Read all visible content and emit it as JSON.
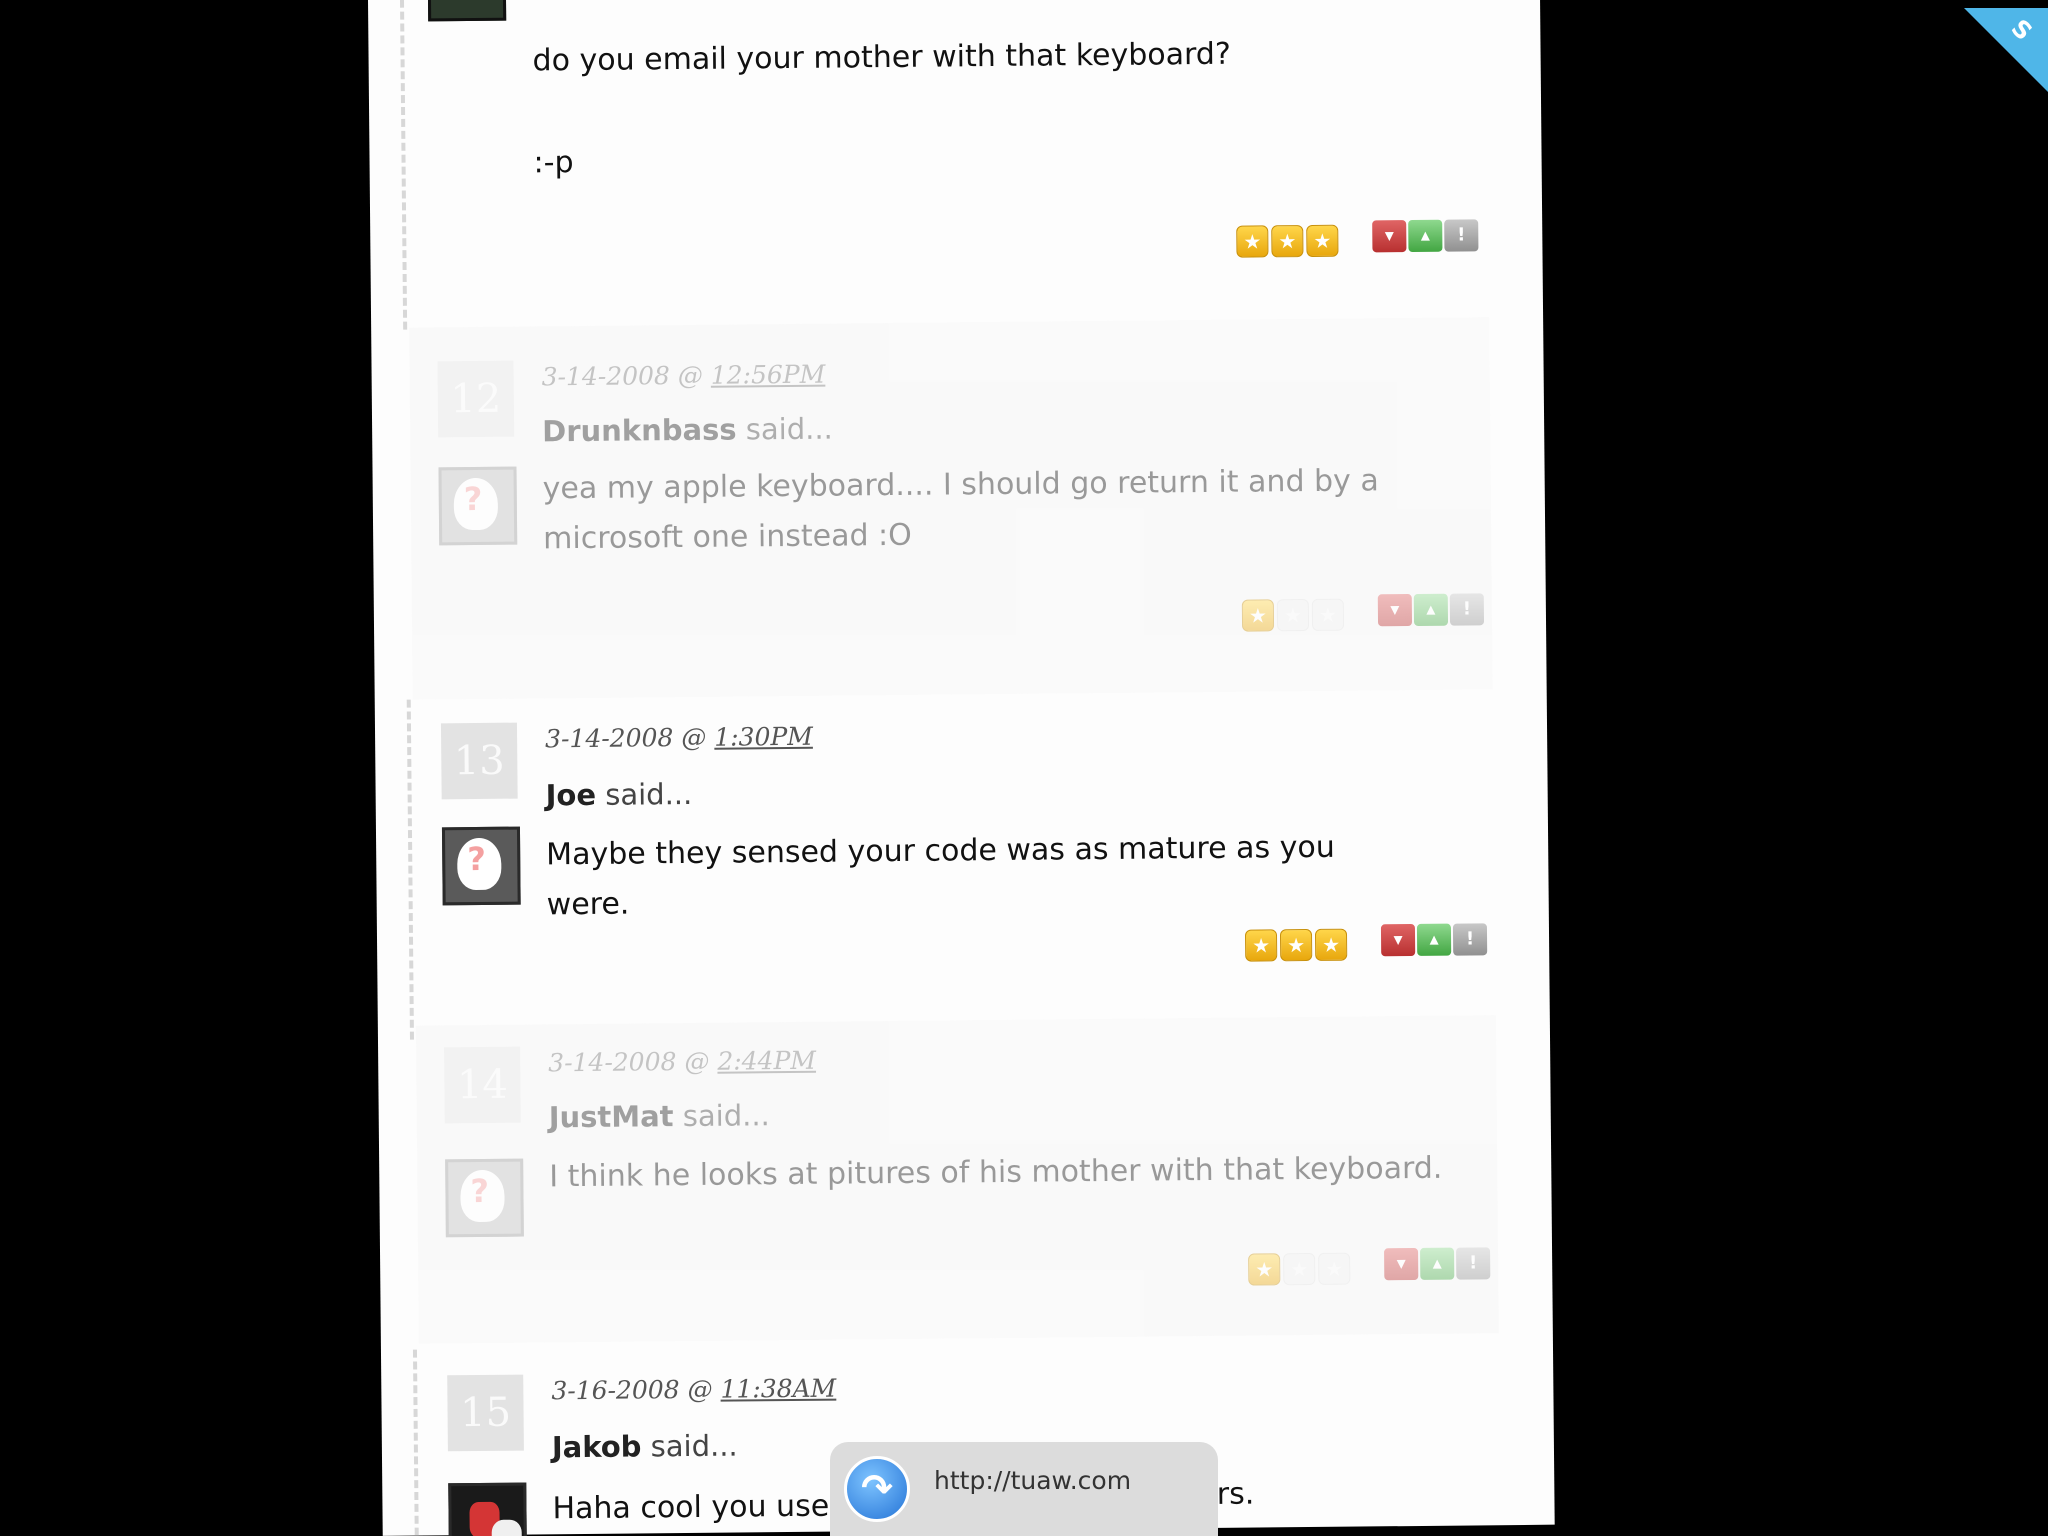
{
  "thread_top": {
    "text_lines": [
      "do you email your mother with that keyboard?",
      ":-p"
    ]
  },
  "comments": [
    {
      "number": "12",
      "date": "3-14-2008",
      "at": "@",
      "time": "12:56PM",
      "author": "Drunknbass",
      "said": "said...",
      "text_lines": [
        "yea my apple keyboard.... I should go return it and by a",
        "microsoft one instead :O"
      ],
      "rating": 1,
      "faded": true
    },
    {
      "number": "13",
      "date": "3-14-2008",
      "at": "@",
      "time": "1:30PM",
      "author": "Joe",
      "said": "said...",
      "text_lines": [
        "Maybe they sensed your code was as mature as you were."
      ],
      "rating": 3,
      "faded": false
    },
    {
      "number": "14",
      "date": "3-14-2008",
      "at": "@",
      "time": "2:44PM",
      "author": "JustMat",
      "said": "said...",
      "text_lines": [
        "I think he looks at pitures of his mother with that keyboard."
      ],
      "rating": 1,
      "faded": true
    },
    {
      "number": "15",
      "date": "3-16-2008",
      "at": "@",
      "time": "11:38AM",
      "author": "Jakob",
      "said": "said...",
      "text_left": "Haha cool you use",
      "text_right": "etters.",
      "faded": false
    }
  ],
  "vote_icons": {
    "down": "arrow-down-icon",
    "up": "arrow-up-icon",
    "flag": "exclamation-icon"
  },
  "toast": {
    "url": "http://tuaw.com",
    "icon": "share-arrow-icon"
  },
  "corner": {
    "glyph": "S",
    "color": "#4fb6e8"
  },
  "colors": {
    "star": "#f2b81c",
    "vote_down": "#c83a3a",
    "vote_up": "#4fb34f",
    "vote_flag": "#a0a0a0"
  }
}
